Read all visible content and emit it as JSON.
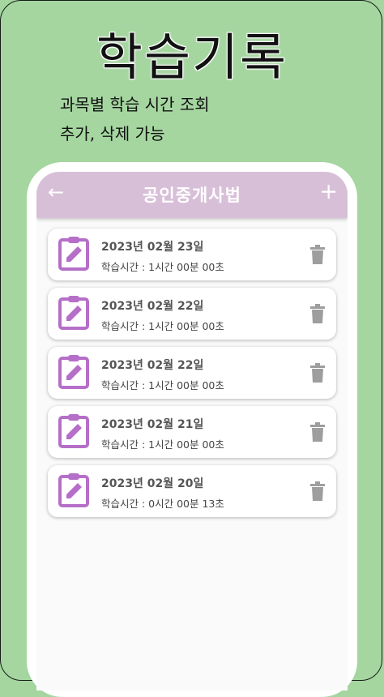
{
  "hero": {
    "title": "학습기록",
    "subtitle_line1": "과목별 학습 시간 조회",
    "subtitle_line2": "추가, 삭제 가능"
  },
  "appbar": {
    "back_icon": "←",
    "title": "공인중개사법",
    "add_icon": "+"
  },
  "records": [
    {
      "date": "2023년 02월 23일",
      "study_time": "학습시간 : 1시간 00분 00초"
    },
    {
      "date": "2023년 02월 22일",
      "study_time": "학습시간 : 1시간 00분 00초"
    },
    {
      "date": "2023년 02월 22일",
      "study_time": "학습시간 : 1시간 00분 00초"
    },
    {
      "date": "2023년 02월 21일",
      "study_time": "학습시간 : 1시간 00분 00초"
    },
    {
      "date": "2023년 02월 20일",
      "study_time": "학습시간 : 0시간 00분 13초"
    }
  ],
  "colors": {
    "background": "#a5d6a0",
    "appbar": "#d8bfd8",
    "icon_purple": "#b56fc8",
    "trash_gray": "#9e9e9e"
  }
}
